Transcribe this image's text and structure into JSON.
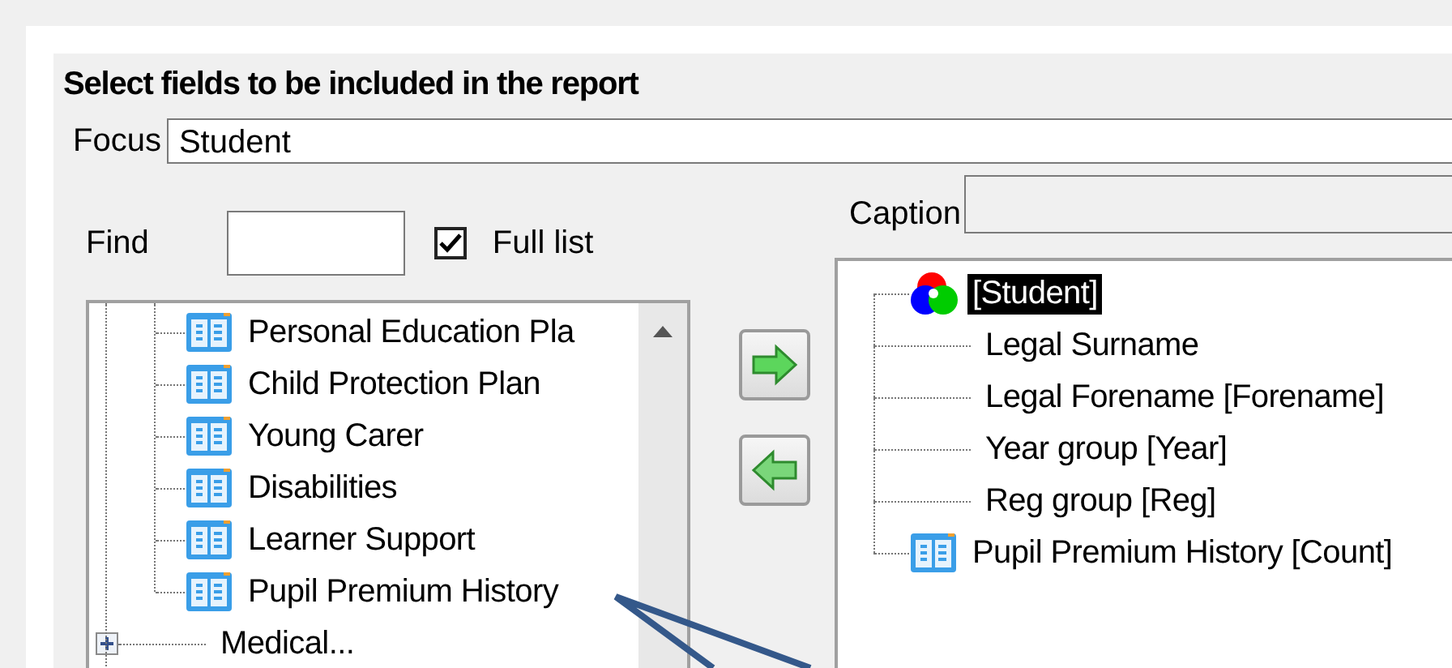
{
  "title": "Select fields to be included in the report",
  "focus": {
    "label": "Focus",
    "value": "Student"
  },
  "find": {
    "label": "Find"
  },
  "full_list": {
    "label": "Full list",
    "checked": true
  },
  "left_tree": [
    {
      "label": "Personal Education Pla",
      "kind": "table"
    },
    {
      "label": "Child Protection Plan",
      "kind": "table"
    },
    {
      "label": "Young Carer",
      "kind": "table"
    },
    {
      "label": "Disabilities",
      "kind": "table"
    },
    {
      "label": "Learner Support",
      "kind": "table"
    },
    {
      "label": "Pupil Premium History",
      "kind": "table"
    },
    {
      "label": "Medical...",
      "kind": "group",
      "expanded": false
    }
  ],
  "caption": {
    "label": "Caption"
  },
  "right_tree": {
    "label": "[Student]",
    "selected": true,
    "children": [
      {
        "label": "Legal Surname",
        "kind": "field"
      },
      {
        "label": "Legal Forename [Forename]",
        "kind": "field"
      },
      {
        "label": "Year group [Year]",
        "kind": "field"
      },
      {
        "label": "Reg group [Reg]",
        "kind": "field"
      },
      {
        "label": "Pupil Premium History [Count]",
        "kind": "table"
      }
    ]
  }
}
